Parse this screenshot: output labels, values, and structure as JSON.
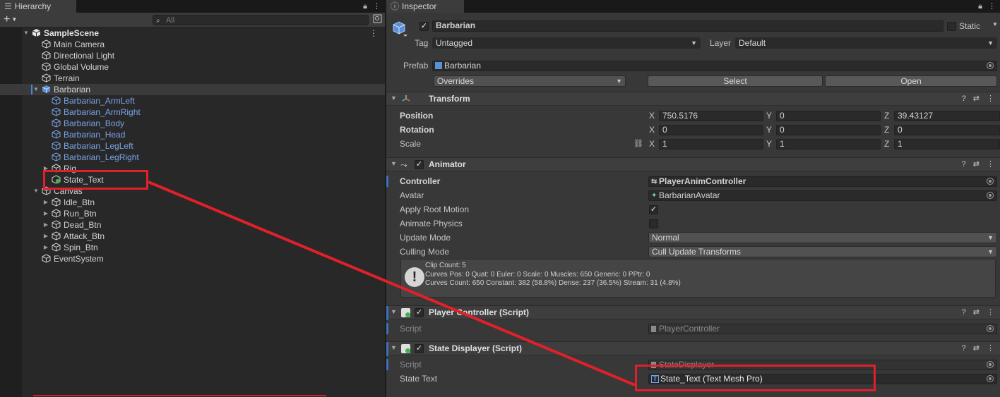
{
  "hierarchy": {
    "tab_label": "Hierarchy",
    "search_placeholder": "All",
    "items": [
      {
        "label": "SampleScene"
      },
      {
        "label": "Main Camera"
      },
      {
        "label": "Directional Light"
      },
      {
        "label": "Global Volume"
      },
      {
        "label": "Terrain"
      },
      {
        "label": "Barbarian"
      },
      {
        "label": "Barbarian_ArmLeft"
      },
      {
        "label": "Barbarian_ArmRight"
      },
      {
        "label": "Barbarian_Body"
      },
      {
        "label": "Barbarian_Head"
      },
      {
        "label": "Barbarian_LegLeft"
      },
      {
        "label": "Barbarian_LegRight"
      },
      {
        "label": "Rig"
      },
      {
        "label": "State_Text"
      },
      {
        "label": "Canvas"
      },
      {
        "label": "Idle_Btn"
      },
      {
        "label": "Run_Btn"
      },
      {
        "label": "Dead_Btn"
      },
      {
        "label": "Attack_Btn"
      },
      {
        "label": "Spin_Btn"
      },
      {
        "label": "EventSystem"
      }
    ]
  },
  "inspector": {
    "tab_label": "Inspector",
    "object_name": "Barbarian",
    "static_label": "Static",
    "tag_label": "Tag",
    "tag_value": "Untagged",
    "layer_label": "Layer",
    "layer_value": "Default",
    "prefab_label": "Prefab",
    "prefab_value": "Barbarian",
    "overrides_label": "Overrides",
    "select_label": "Select",
    "open_label": "Open",
    "transform": {
      "title": "Transform",
      "rows": [
        {
          "label": "Position",
          "x": "750.5176",
          "y": "0",
          "z": "39.43127"
        },
        {
          "label": "Rotation",
          "x": "0",
          "y": "0",
          "z": "0"
        },
        {
          "label": "Scale",
          "x": "1",
          "y": "1",
          "z": "1"
        }
      ],
      "axis": {
        "x": "X",
        "y": "Y",
        "z": "Z"
      }
    },
    "animator": {
      "title": "Animator",
      "controller_label": "Controller",
      "controller_value": "PlayerAnimController",
      "avatar_label": "Avatar",
      "avatar_value": "BarbarianAvatar",
      "apply_root_motion_label": "Apply Root Motion",
      "animate_physics_label": "Animate Physics",
      "update_mode_label": "Update Mode",
      "update_mode_value": "Normal",
      "culling_mode_label": "Culling Mode",
      "culling_mode_value": "Cull Update Transforms",
      "info_lines": [
        "Clip Count: 5",
        "Curves Pos: 0 Quat: 0 Euler: 0 Scale: 0 Muscles: 650 Generic: 0 PPtr: 0",
        "Curves Count: 650 Constant: 382 (58.8%) Dense: 237 (36.5%) Stream: 31 (4.8%)"
      ]
    },
    "player_controller": {
      "title": "Player Controller (Script)",
      "script_label": "Script",
      "script_value": "PlayerController"
    },
    "state_displayer": {
      "title": "State Displayer (Script)",
      "script_label": "Script",
      "script_value": "StateDisplayer",
      "state_text_label": "State Text",
      "state_text_value": "State_Text (Text Mesh Pro)"
    }
  },
  "colors": {
    "annotation_red": "#e0202a",
    "prefab_blue": "#7aa3e8",
    "panel_bg": "#383838"
  }
}
